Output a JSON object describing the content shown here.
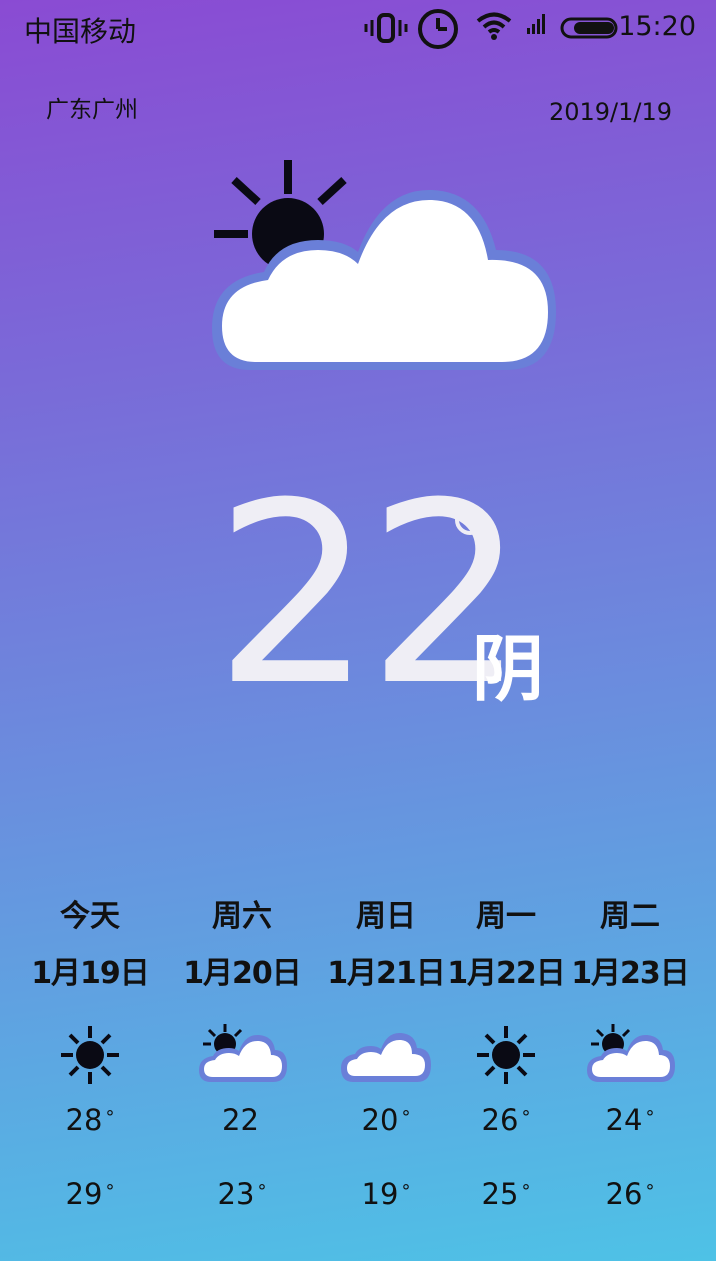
{
  "status_bar": {
    "carrier": "中国移动",
    "time": "15:20",
    "icons": [
      "vibrate-icon",
      "clock-icon",
      "wifi-icon",
      "signal-icon",
      "battery-icon"
    ]
  },
  "header": {
    "location": "广东广州",
    "date": "2019/1/19"
  },
  "current": {
    "temperature": "22",
    "condition": "阴",
    "icon": "sun-behind-cloud-icon"
  },
  "forecast": [
    {
      "day": "今天",
      "date": "1月19日",
      "icon": "sun-icon",
      "high": "28",
      "high_deg": "°",
      "low": "29",
      "low_deg": "°"
    },
    {
      "day": "周六",
      "date": "1月20日",
      "icon": "sun-behind-cloud-icon",
      "high": "22",
      "high_deg": "",
      "low": "23",
      "low_deg": "°"
    },
    {
      "day": "周日",
      "date": "1月21日",
      "icon": "cloud-icon",
      "high": "20",
      "high_deg": "°",
      "low": "19",
      "low_deg": "°"
    },
    {
      "day": "周一",
      "date": "1月22日",
      "icon": "sun-icon",
      "high": "26",
      "high_deg": "°",
      "low": "25",
      "low_deg": "°"
    },
    {
      "day": "周二",
      "date": "1月23日",
      "icon": "sun-behind-cloud-icon",
      "high": "24",
      "high_deg": "°",
      "low": "26",
      "low_deg": "°"
    }
  ],
  "colors": {
    "gradient_top": "#8a4bd3",
    "gradient_bottom": "#4ec2e6",
    "cloud_fill": "#ffffff",
    "cloud_outline": "#6a7fd8",
    "sun": "#0a0a14"
  }
}
